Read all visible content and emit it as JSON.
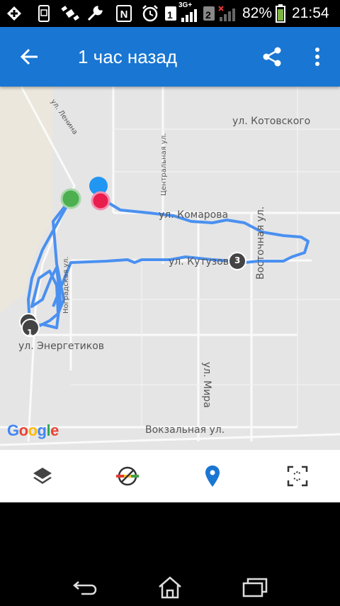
{
  "status_bar": {
    "sim1_label": "1",
    "network_label": "3G+",
    "sim2_label": "2",
    "battery_percent": "82%",
    "time": "21:54",
    "icons": [
      "plus-icon",
      "phone-settings-icon",
      "satellite-icon",
      "wrench-icon",
      "nfc-icon",
      "alarm-icon",
      "signal-icon",
      "battery-icon"
    ]
  },
  "app_bar": {
    "title": "1 час назад",
    "color": "#1976d2"
  },
  "map": {
    "streets": {
      "lenina": "ул. Ленина",
      "kotovskogo": "ул. Котовского",
      "centralnaya": "Центральная ул.",
      "komarova": "ул. Комарова",
      "vostochnaya": "Восточная ул.",
      "kutuzova": "ул. Кутузов",
      "nogradskaya": "Ноградская ул.",
      "energetikov": "ул. Энергетиков",
      "mira": "ул. Мира",
      "vokzalnaya": "Вокзальная ул."
    },
    "markers": {
      "start_color": "#4caf50",
      "end_color": "#e91e4c",
      "current_color": "#2196f3",
      "track_color": "#4a90f0",
      "waypoint_1": "1",
      "waypoint_3": "3"
    },
    "logo": {
      "letters": [
        "G",
        "o",
        "o",
        "g",
        "l",
        "e"
      ],
      "colors": [
        "#4285f4",
        "#ea4335",
        "#fbbc05",
        "#4285f4",
        "#34a853",
        "#ea4335"
      ]
    }
  },
  "toolbar": {
    "items": [
      {
        "icon": "layers-icon",
        "active": false
      },
      {
        "icon": "speed-filter-icon",
        "active": false
      },
      {
        "icon": "location-pin-icon",
        "active": true
      },
      {
        "icon": "fit-bounds-icon",
        "active": false
      }
    ],
    "active_color": "#1976d2"
  },
  "nav_bar": {
    "items": [
      "back-nav-icon",
      "home-nav-icon",
      "recents-nav-icon"
    ]
  }
}
